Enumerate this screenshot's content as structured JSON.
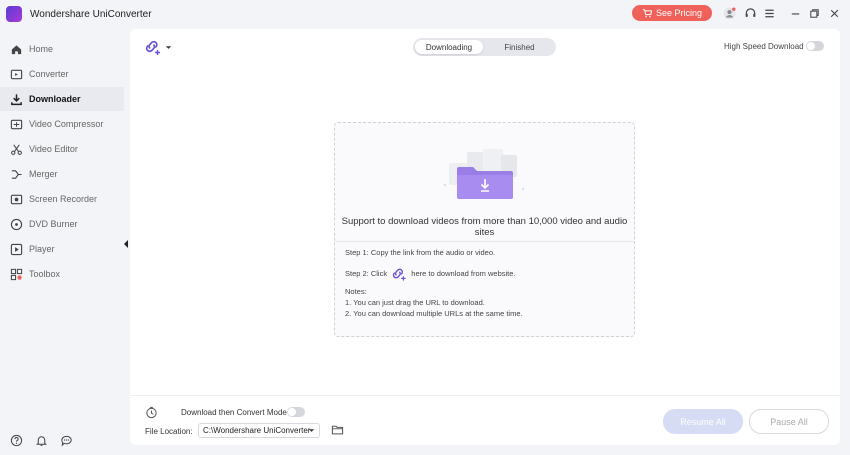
{
  "app": {
    "title": "Wondershare UniConverter"
  },
  "titlebar": {
    "pricing_label": "See Pricing"
  },
  "sidebar": {
    "items": [
      {
        "label": "Home",
        "icon": "home-icon"
      },
      {
        "label": "Converter",
        "icon": "converter-icon"
      },
      {
        "label": "Downloader",
        "icon": "download-icon",
        "active": true
      },
      {
        "label": "Video Compressor",
        "icon": "compress-icon"
      },
      {
        "label": "Video Editor",
        "icon": "scissors-icon"
      },
      {
        "label": "Merger",
        "icon": "merge-icon"
      },
      {
        "label": "Screen Recorder",
        "icon": "record-icon"
      },
      {
        "label": "DVD Burner",
        "icon": "disc-icon"
      },
      {
        "label": "Player",
        "icon": "play-icon"
      },
      {
        "label": "Toolbox",
        "icon": "grid-icon"
      }
    ]
  },
  "tabs": {
    "downloading": "Downloading",
    "finished": "Finished"
  },
  "high_speed": {
    "label": "High Speed Download",
    "enabled": false
  },
  "dropzone": {
    "title": "Support to download videos from more than 10,000 video and audio sites",
    "step1": "Step 1: Copy the link from the audio or video.",
    "step2_prefix": "Step 2: Click",
    "step2_suffix": "here to download from website.",
    "notes_title": "Notes:",
    "note1": "1. You can just drag the URL to download.",
    "note2": "2. You can download multiple URLs at the same time."
  },
  "bottom": {
    "convert_mode_label": "Download then Convert Mode",
    "convert_mode_enabled": false,
    "file_location_label": "File Location:",
    "file_location_value": "C:\\Wondershare UniConverter",
    "resume_all": "Resume All",
    "pause_all": "Pause All"
  },
  "colors": {
    "accent": "#6b4ed8",
    "pricing": "#f0615a"
  }
}
